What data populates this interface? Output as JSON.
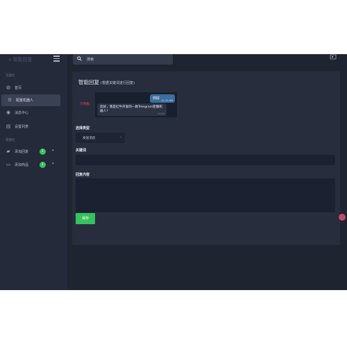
{
  "sidebar": {
    "brand": "a 智能回复",
    "sections": [
      "功能栏",
      "客服栏"
    ],
    "items": [
      {
        "label": "首页",
        "icon": "dashboard-icon"
      },
      {
        "label": "配置机器人",
        "icon": "gear-icon"
      },
      {
        "label": "消息中心",
        "icon": "globe-icon"
      },
      {
        "label": "设置列表",
        "icon": "table-icon"
      },
      {
        "label": "添加回复",
        "icon": "chat-icon",
        "badge": "1"
      },
      {
        "label": "添加商品",
        "icon": "monitor-icon",
        "badge": "1"
      }
    ]
  },
  "topbar": {
    "search_text": "搜索"
  },
  "card": {
    "title": "智能回复",
    "subtitle": "(根据关键词进行回复)",
    "preview_label": "示例图:",
    "chat": {
      "outgoing": "你好",
      "outgoing_time": "11:10 AM",
      "incoming": "您好，我是红牛开发的一款Telegram客服机器人！",
      "incoming_time": "11:10"
    },
    "fields": {
      "type_label": "选择类型",
      "type_value": "发送消息",
      "keyword_label": "关键词",
      "content_label": "回复内容"
    },
    "save_label": "保存"
  },
  "colors": {
    "sidebar_bg": "#242a3a",
    "main_bg": "#1f2431",
    "card_bg": "#272d3d",
    "accent": "#36c25d",
    "preview_label": "#e0474c"
  }
}
